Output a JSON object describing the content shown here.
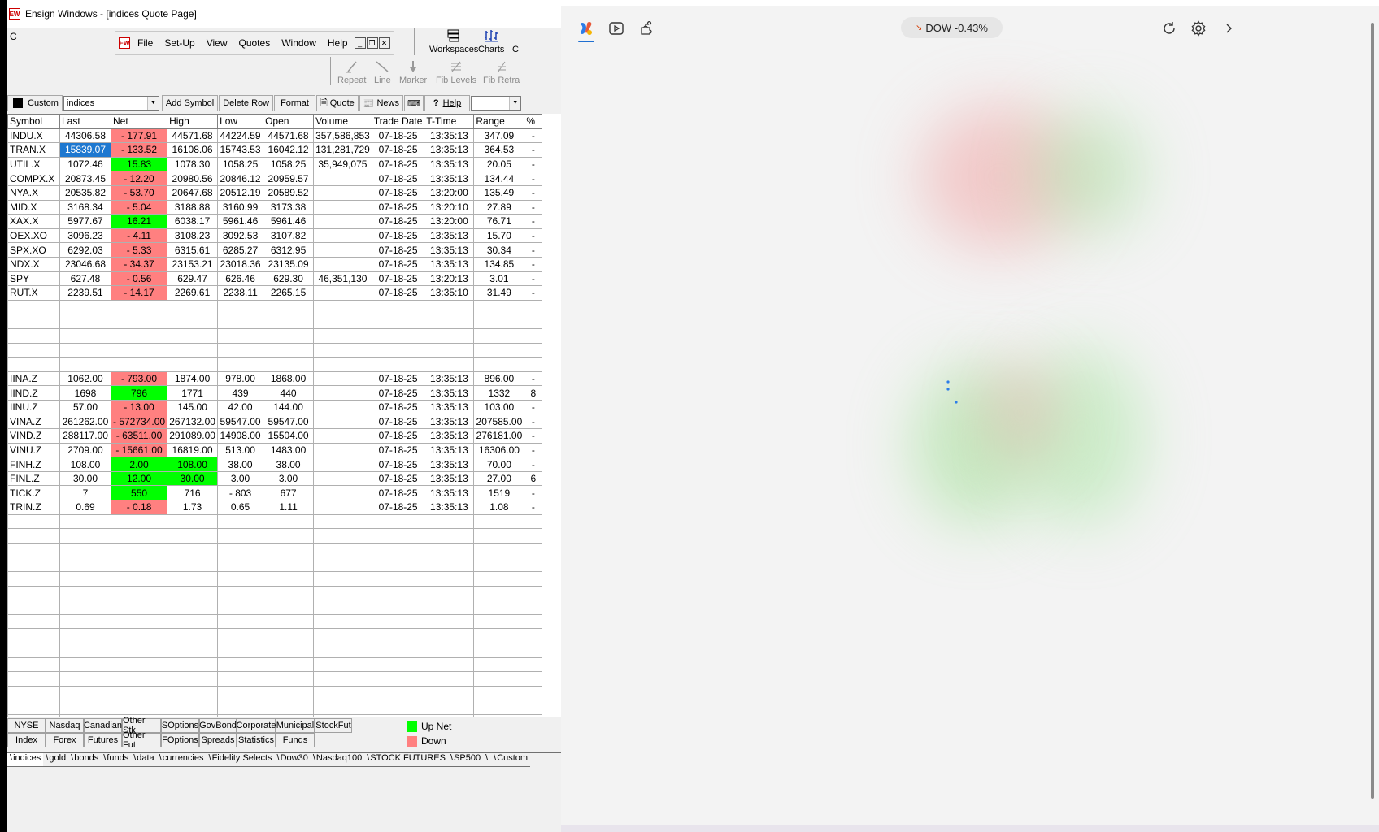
{
  "window": {
    "title": "Ensign Windows - [indices Quote Page]",
    "logo_text": "EW",
    "corner_letter": "C"
  },
  "menu": [
    "File",
    "Set-Up",
    "View",
    "Quotes",
    "Window",
    "Help"
  ],
  "toolbar_big": [
    "Workspaces",
    "Charts",
    "C"
  ],
  "draw_tools": [
    "Repeat",
    "Line",
    "Marker",
    "Fib Levels",
    "Fib Retra"
  ],
  "toolbar2": {
    "custom": "Custom",
    "page_combo": "indices",
    "add_symbol": "Add Symbol",
    "delete_row": "Delete Row",
    "format": "Format",
    "quote": "Quote",
    "news": "News",
    "help": "Help"
  },
  "columns": [
    "Symbol",
    "Last",
    "Net",
    "High",
    "Low",
    "Open",
    "Volume",
    "Trade Date",
    "T-Time",
    "Range",
    "%"
  ],
  "rows_top": [
    {
      "symbol": "INDU.X",
      "last": "44306.58",
      "net": "- 177.91",
      "dir": "down",
      "high": "44571.68",
      "low": "44224.59",
      "open": "44571.68",
      "volume": "357,586,853",
      "date": "07-18-25",
      "time": "13:35:13",
      "range": "347.09",
      "pct": "-"
    },
    {
      "symbol": "TRAN.X",
      "last": "15839.07",
      "net": "- 133.52",
      "dir": "down",
      "high": "16108.06",
      "low": "15743.53",
      "open": "16042.12",
      "volume": "131,281,729",
      "date": "07-18-25",
      "time": "13:35:13",
      "range": "364.53",
      "pct": "-",
      "selected": true
    },
    {
      "symbol": "UTIL.X",
      "last": "1072.46",
      "net": "15.83",
      "dir": "up",
      "high": "1078.30",
      "low": "1058.25",
      "open": "1058.25",
      "volume": "35,949,075",
      "date": "07-18-25",
      "time": "13:35:13",
      "range": "20.05",
      "pct": "-"
    },
    {
      "symbol": "COMPX.X",
      "last": "20873.45",
      "net": "- 12.20",
      "dir": "down",
      "high": "20980.56",
      "low": "20846.12",
      "open": "20959.57",
      "volume": "",
      "date": "07-18-25",
      "time": "13:35:13",
      "range": "134.44",
      "pct": "-"
    },
    {
      "symbol": "NYA.X",
      "last": "20535.82",
      "net": "- 53.70",
      "dir": "down",
      "high": "20647.68",
      "low": "20512.19",
      "open": "20589.52",
      "volume": "",
      "date": "07-18-25",
      "time": "13:20:00",
      "range": "135.49",
      "pct": "-"
    },
    {
      "symbol": "MID.X",
      "last": "3168.34",
      "net": "- 5.04",
      "dir": "down",
      "high": "3188.88",
      "low": "3160.99",
      "open": "3173.38",
      "volume": "",
      "date": "07-18-25",
      "time": "13:20:10",
      "range": "27.89",
      "pct": "-"
    },
    {
      "symbol": "XAX.X",
      "last": "5977.67",
      "net": "16.21",
      "dir": "up",
      "high": "6038.17",
      "low": "5961.46",
      "open": "5961.46",
      "volume": "",
      "date": "07-18-25",
      "time": "13:20:00",
      "range": "76.71",
      "pct": "-"
    },
    {
      "symbol": "OEX.XO",
      "last": "3096.23",
      "net": "- 4.11",
      "dir": "down",
      "high": "3108.23",
      "low": "3092.53",
      "open": "3107.82",
      "volume": "",
      "date": "07-18-25",
      "time": "13:35:13",
      "range": "15.70",
      "pct": "-"
    },
    {
      "symbol": "SPX.XO",
      "last": "6292.03",
      "net": "- 5.33",
      "dir": "down",
      "high": "6315.61",
      "low": "6285.27",
      "open": "6312.95",
      "volume": "",
      "date": "07-18-25",
      "time": "13:35:13",
      "range": "30.34",
      "pct": "-"
    },
    {
      "symbol": "NDX.X",
      "last": "23046.68",
      "net": "- 34.37",
      "dir": "down",
      "high": "23153.21",
      "low": "23018.36",
      "open": "23135.09",
      "volume": "",
      "date": "07-18-25",
      "time": "13:35:13",
      "range": "134.85",
      "pct": "-"
    },
    {
      "symbol": "SPY",
      "last": "627.48",
      "net": "- 0.56",
      "dir": "down",
      "high": "629.47",
      "low": "626.46",
      "open": "629.30",
      "volume": "46,351,130",
      "date": "07-18-25",
      "time": "13:20:13",
      "range": "3.01",
      "pct": "-"
    },
    {
      "symbol": "RUT.X",
      "last": "2239.51",
      "net": "- 14.17",
      "dir": "down",
      "high": "2269.61",
      "low": "2238.11",
      "open": "2265.15",
      "volume": "",
      "date": "07-18-25",
      "time": "13:35:10",
      "range": "31.49",
      "pct": "-"
    }
  ],
  "rows_bottom": [
    {
      "symbol": "IINA.Z",
      "last": "1062.00",
      "net": "- 793.00",
      "dir": "down",
      "high": "1874.00",
      "high_dir": "",
      "low": "978.00",
      "open": "1868.00",
      "volume": "",
      "date": "07-18-25",
      "time": "13:35:13",
      "range": "896.00",
      "pct": "-"
    },
    {
      "symbol": "IIND.Z",
      "last": "1698",
      "net": "796",
      "dir": "up",
      "high": "1771",
      "high_dir": "",
      "low": "439",
      "open": "440",
      "volume": "",
      "date": "07-18-25",
      "time": "13:35:13",
      "range": "1332",
      "pct": "8"
    },
    {
      "symbol": "IINU.Z",
      "last": "57.00",
      "net": "- 13.00",
      "dir": "down",
      "high": "145.00",
      "high_dir": "",
      "low": "42.00",
      "open": "144.00",
      "volume": "",
      "date": "07-18-25",
      "time": "13:35:13",
      "range": "103.00",
      "pct": "-"
    },
    {
      "symbol": "VINA.Z",
      "last": "261262.00",
      "net": "- 572734.00",
      "dir": "down",
      "high": "267132.00",
      "high_dir": "",
      "low": "59547.00",
      "open": "59547.00",
      "volume": "",
      "date": "07-18-25",
      "time": "13:35:13",
      "range": "207585.00",
      "pct": "-"
    },
    {
      "symbol": "VIND.Z",
      "last": "288117.00",
      "net": "- 63511.00",
      "dir": "down",
      "high": "291089.00",
      "high_dir": "",
      "low": "14908.00",
      "open": "15504.00",
      "volume": "",
      "date": "07-18-25",
      "time": "13:35:13",
      "range": "276181.00",
      "pct": "-"
    },
    {
      "symbol": "VINU.Z",
      "last": "2709.00",
      "net": "- 15661.00",
      "dir": "down",
      "high": "16819.00",
      "high_dir": "",
      "low": "513.00",
      "open": "1483.00",
      "volume": "",
      "date": "07-18-25",
      "time": "13:35:13",
      "range": "16306.00",
      "pct": "-"
    },
    {
      "symbol": "FINH.Z",
      "last": "108.00",
      "net": "2.00",
      "dir": "up",
      "high": "108.00",
      "high_dir": "up",
      "low": "38.00",
      "open": "38.00",
      "volume": "",
      "date": "07-18-25",
      "time": "13:35:13",
      "range": "70.00",
      "pct": "-"
    },
    {
      "symbol": "FINL.Z",
      "last": "30.00",
      "net": "12.00",
      "dir": "up",
      "high": "30.00",
      "high_dir": "up",
      "low": "3.00",
      "open": "3.00",
      "volume": "",
      "date": "07-18-25",
      "time": "13:35:13",
      "range": "27.00",
      "pct": "6"
    },
    {
      "symbol": "TICK.Z",
      "last": "7",
      "net": "550",
      "dir": "up",
      "high": "716",
      "high_dir": "",
      "low": "- 803",
      "open": "677",
      "volume": "",
      "date": "07-18-25",
      "time": "13:35:13",
      "range": "1519",
      "pct": "-"
    },
    {
      "symbol": "TRIN.Z",
      "last": "0.69",
      "net": "- 0.18",
      "dir": "down",
      "high": "1.73",
      "high_dir": "",
      "low": "0.65",
      "open": "1.11",
      "volume": "",
      "date": "07-18-25",
      "time": "13:35:13",
      "range": "1.08",
      "pct": "-"
    }
  ],
  "bottom_buttons_row1": [
    "NYSE",
    "Nasdaq",
    "Canadian",
    "Other Stk",
    "SOptions",
    "GovBond",
    "Corporate",
    "Municipal",
    "StockFut"
  ],
  "bottom_buttons_row2": [
    "Index",
    "Forex",
    "Futures",
    "Other Fut",
    "FOptions",
    "Spreads",
    "Statistics",
    "Funds"
  ],
  "legend": {
    "up": "Up Net",
    "down": "Down",
    "up_color": "#00ff00",
    "down_color": "#ff8080"
  },
  "sheet_tabs": [
    "indices",
    "gold",
    "bonds",
    "funds",
    "data",
    "currencies",
    "Fidelity Selects",
    "Dow30",
    "Nasdaq100",
    "STOCK FUTURES",
    "SP500",
    "",
    "Custom"
  ],
  "right_panel": {
    "ticker_text": "DOW -0.43%",
    "icons": [
      "copilot-icon",
      "video-icon",
      "puzzle-icon",
      "refresh-icon",
      "settings-icon",
      "chevron-right-icon"
    ]
  },
  "colors": {
    "up": "#00ff00",
    "down": "#ff8080",
    "selected": "#1e78d0",
    "accent": "#1f6fd1"
  }
}
